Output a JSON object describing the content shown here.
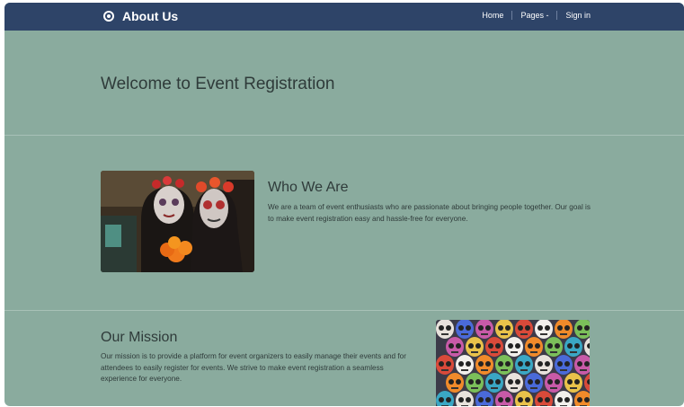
{
  "navbar": {
    "brand": "About Us",
    "links": [
      "Home",
      "Pages -",
      "Sign in"
    ]
  },
  "hero": {
    "title": "Welcome to Event Registration"
  },
  "who_we_are": {
    "title": "Who We Are",
    "text": "We are a team of event enthusiasts who are passionate about bringing people together. Our goal is to make event registration easy and hassle-free for everyone.",
    "image": "day-of-the-dead-couple-photo"
  },
  "our_mission": {
    "title": "Our Mission",
    "text": "Our mission is to provide a platform for event organizers to easily manage their events and for attendees to easily register for events. We strive to make event registration a seamless experience for everyone.",
    "image": "sugar-skulls-photo"
  },
  "colors": {
    "navbar": "#2e4468",
    "background": "#8aab9e",
    "text": "#2f3b3a"
  }
}
